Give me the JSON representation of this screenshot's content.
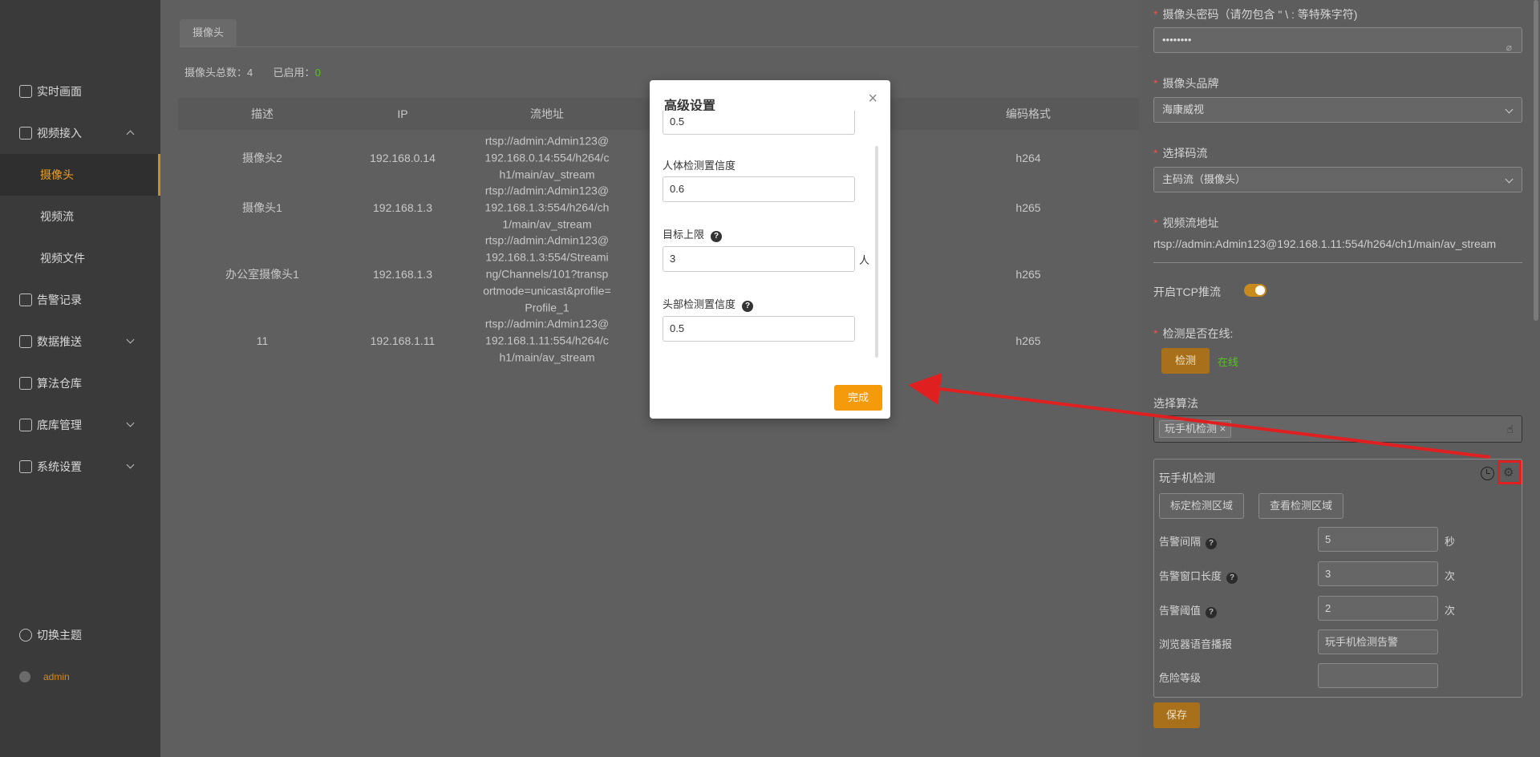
{
  "sidebar": {
    "items": [
      {
        "label": "实时画面"
      },
      {
        "label": "视频接入"
      },
      {
        "label": "摄像头"
      },
      {
        "label": "视频流"
      },
      {
        "label": "视频文件"
      },
      {
        "label": "告警记录"
      },
      {
        "label": "数据推送"
      },
      {
        "label": "算法仓库"
      },
      {
        "label": "底库管理"
      },
      {
        "label": "系统设置"
      }
    ],
    "theme_label": "切换主题",
    "user_label": "admin"
  },
  "main": {
    "tab_label": "摄像头",
    "stats": {
      "total_label": "摄像头总数：",
      "total_value": "4",
      "enabled_label": "已启用：",
      "enabled_value": "0"
    },
    "columns": [
      "描述",
      "IP",
      "流地址",
      "编码格式"
    ],
    "rows": [
      {
        "desc": "摄像头2",
        "ip": "192.168.0.14",
        "stream": "rtsp://admin:Admin123@192.168.0.14:554/h264/ch1/main/av_stream",
        "codec": "h264"
      },
      {
        "desc": "摄像头1",
        "ip": "192.168.1.3",
        "stream": "rtsp://admin:Admin123@192.168.1.3:554/h264/ch1/main/av_stream",
        "codec": "h265"
      },
      {
        "desc": "办公室摄像头1",
        "ip": "192.168.1.3",
        "stream": "rtsp://admin:Admin123@192.168.1.3:554/Streaming/Channels/101?transportmode=unicast&profile=Profile_1",
        "codec": "h265"
      },
      {
        "desc": "11",
        "ip": "192.168.1.11",
        "stream": "rtsp://admin:Admin123@192.168.1.11:554/h264/ch1/main/av_stream",
        "codec": "h265"
      }
    ]
  },
  "drawer": {
    "password_label": "摄像头密码（请勿包含 \" \\ : 等特殊字符)",
    "password_value": "••••••••",
    "brand_label": "摄像头品牌",
    "brand_value": "海康威视",
    "stream_type_label": "选择码流",
    "stream_type_value": "主码流（摄像头）",
    "stream_url_label": "视频流地址",
    "stream_url_value": "rtsp://admin:Admin123@192.168.1.11:554/h264/ch1/main/av_stream",
    "tcp_label": "开启TCP推流",
    "tcp_enabled": true,
    "online_check_label": "检测是否在线:",
    "check_button": "检测",
    "online_status": "在线",
    "algo_label": "选择算法",
    "algo_tag": "玩手机检测",
    "card": {
      "title": "玩手机检测",
      "mark_button": "标定检测区域",
      "view_button": "查看检测区域",
      "fields": [
        {
          "label": "告警间隔",
          "value": "5",
          "unit": "秒",
          "help": true
        },
        {
          "label": "告警窗口长度",
          "value": "3",
          "unit": "次",
          "help": true
        },
        {
          "label": "告警阈值",
          "value": "2",
          "unit": "次",
          "help": true
        },
        {
          "label": "浏览器语音播报",
          "value": "玩手机检测告警",
          "unit": "",
          "help": false
        },
        {
          "label": "危险等级",
          "value": "",
          "unit": "",
          "help": false
        }
      ]
    },
    "save_button": "保存"
  },
  "modal": {
    "title": "高级设置",
    "top_value": "0.5",
    "fields": [
      {
        "label": "人体检测置信度",
        "value": "0.6",
        "unit": "",
        "help": false
      },
      {
        "label": "目标上限",
        "value": "3",
        "unit": "人",
        "help": true
      },
      {
        "label": "头部检测置信度",
        "value": "0.5",
        "unit": "",
        "help": true
      }
    ],
    "done_button": "完成"
  },
  "colors": {
    "accent": "#f59a0b",
    "online": "#52c41a",
    "highlight": "#e02020"
  },
  "icons": [
    "monitor-icon",
    "video-icon",
    "alarm-icon",
    "chart-icon",
    "warehouse-icon",
    "database-icon",
    "gear-icon",
    "moon-icon",
    "clock-icon",
    "hand-icon",
    "close-icon",
    "help-icon",
    "eye-off-icon"
  ]
}
